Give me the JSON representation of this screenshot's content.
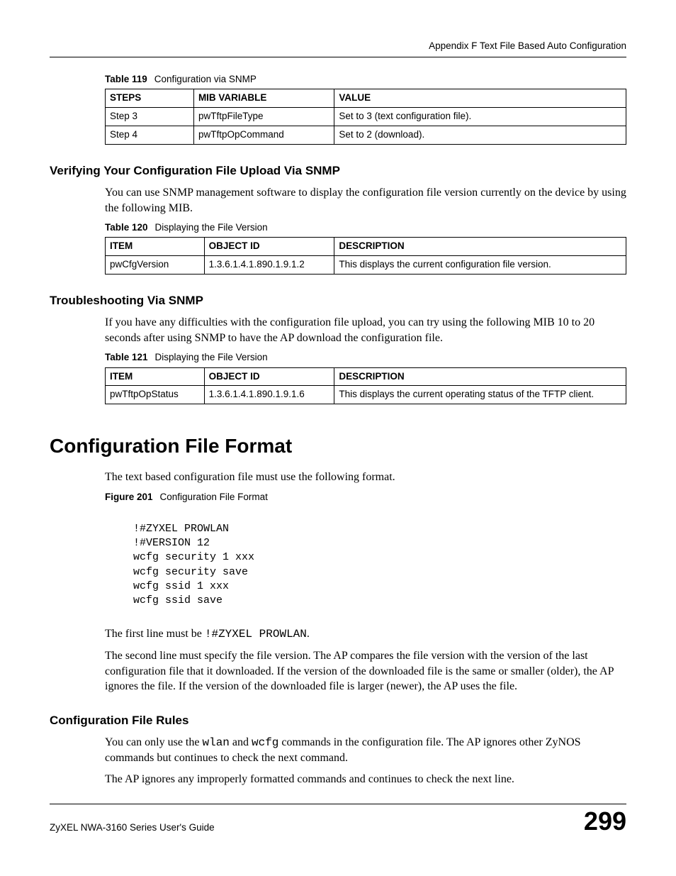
{
  "running_header": "Appendix F Text File Based Auto Configuration",
  "table119": {
    "caption_label": "Table 119",
    "caption_title": "Configuration via SNMP",
    "headers": [
      "STEPS",
      "MIB VARIABLE",
      "VALUE"
    ],
    "rows": [
      [
        "Step 3",
        "pwTftpFileType",
        "Set to 3 (text configuration file)."
      ],
      [
        "Step 4",
        "pwTftpOpCommand",
        "Set to 2 (download)."
      ]
    ]
  },
  "sec_verify": {
    "heading": "Verifying Your Configuration File Upload Via SNMP",
    "para": "You can use SNMP management software to display the configuration file version currently on the device by using the following MIB."
  },
  "table120": {
    "caption_label": "Table 120",
    "caption_title": "Displaying the File Version",
    "headers": [
      "ITEM",
      "OBJECT ID",
      "DESCRIPTION"
    ],
    "rows": [
      [
        "pwCfgVersion",
        "1.3.6.1.4.1.890.1.9.1.2",
        "This displays the current configuration file version."
      ]
    ]
  },
  "sec_trouble": {
    "heading": "Troubleshooting Via SNMP",
    "para": "If you have any difficulties with the configuration file upload, you can try using the following MIB 10 to 20 seconds after using SNMP to have the AP download the configuration file."
  },
  "table121": {
    "caption_label": "Table 121",
    "caption_title": "Displaying the File Version",
    "headers": [
      "ITEM",
      "OBJECT ID",
      "DESCRIPTION"
    ],
    "rows": [
      [
        "pwTftpOpStatus",
        "1.3.6.1.4.1.890.1.9.1.6",
        "This displays the current operating status of the TFTP client."
      ]
    ]
  },
  "sec_format": {
    "heading": "Configuration File Format",
    "para": "The text based configuration file must use the following format."
  },
  "figure201": {
    "caption_label": "Figure 201",
    "caption_title": "Configuration File Format",
    "code": "!#ZYXEL PROWLAN\n!#VERSION 12\nwcfg security 1 xxx\nwcfg security save\nwcfg ssid 1 xxx\nwcfg ssid save"
  },
  "firstline": {
    "prefix": "The first line must be ",
    "code": "!#ZYXEL PROWLAN",
    "suffix": "."
  },
  "secondline_para": "The second line must specify the file version. The AP compares the file version with the version of the last configuration file that it downloaded. If the version of the downloaded file is the same or smaller (older), the AP ignores the file. If the version of the downloaded file is larger (newer), the AP uses the file.",
  "sec_rules": {
    "heading": "Configuration File Rules",
    "p1_a": "You can only use the ",
    "p1_code1": "wlan",
    "p1_b": " and ",
    "p1_code2": "wcfg",
    "p1_c": " commands in the configuration file. The AP ignores other ZyNOS commands but continues to check the next command.",
    "p2": "The AP ignores any improperly formatted commands and continues to check the next line."
  },
  "footer": {
    "guide": "ZyXEL NWA-3160 Series User's Guide",
    "page": "299"
  }
}
